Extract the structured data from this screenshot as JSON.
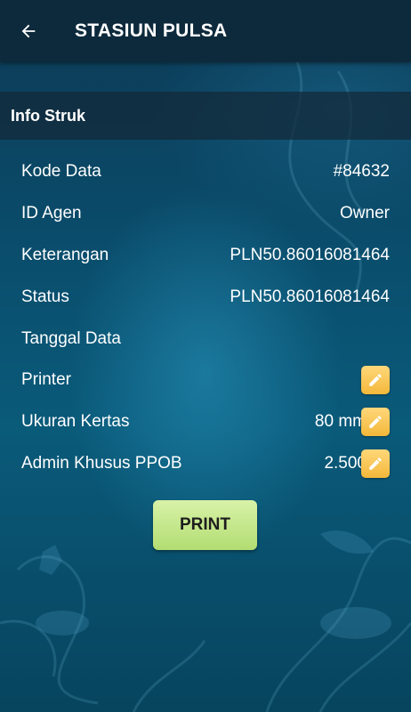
{
  "appbar": {
    "title": "STASIUN PULSA",
    "back_icon": "arrow-left-icon"
  },
  "section": {
    "title": "Info Struk"
  },
  "rows": [
    {
      "label": "Kode Data",
      "value": "#84632"
    },
    {
      "label": "ID Agen",
      "value": "Owner"
    },
    {
      "label": "Keterangan",
      "value": "PLN50.86016081464"
    },
    {
      "label": "Status",
      "value": "PLN50.86016081464"
    },
    {
      "label": "Tanggal Data",
      "value": ""
    },
    {
      "label": "Printer",
      "value": "-",
      "editable": true
    },
    {
      "label": "Ukuran Kertas",
      "value": "80 mm",
      "editable": true
    },
    {
      "label": "Admin Khusus PPOB",
      "value": "2.500",
      "editable": true
    }
  ],
  "print_button": {
    "label": "PRINT"
  },
  "colors": {
    "appbar": "#0d2a3c",
    "edit_button": "#f3b83a",
    "print_button": "#b2dd72"
  }
}
